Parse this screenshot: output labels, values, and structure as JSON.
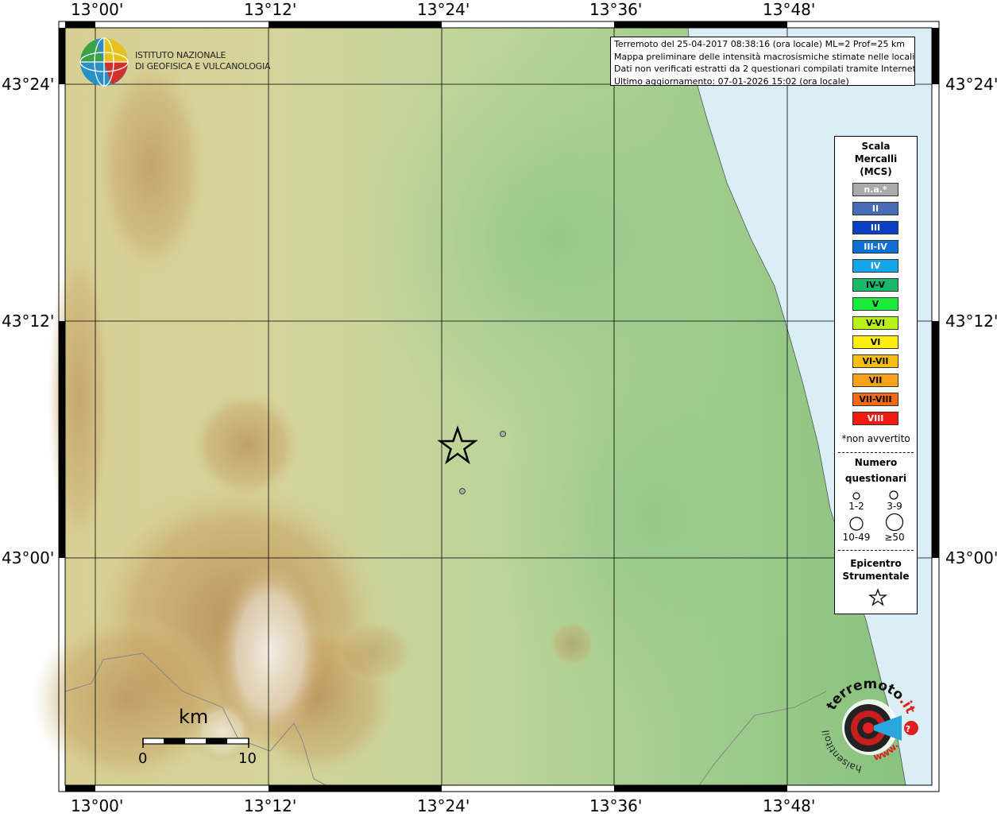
{
  "map": {
    "lon_ticks": [
      "13°00'",
      "13°12'",
      "13°24'",
      "13°36'",
      "13°48'"
    ],
    "lat_ticks": [
      "43°24'",
      "43°12'",
      "43°00'"
    ],
    "epicenter": {
      "lon": "13°24'",
      "lat": "43°06'"
    },
    "reports": [
      {
        "intensity": "n.a.*",
        "count": "1-2"
      },
      {
        "intensity": "n.a.*",
        "count": "1-2"
      }
    ],
    "colors": {
      "sea": "#dbeef6",
      "lowland": "#9cc98c",
      "hills": "#dcd49a",
      "mountains": "#b48a52",
      "peaks": "#f2efe8"
    }
  },
  "info": {
    "line1": "Terremoto del 25-04-2017 08:38:16 (ora locale) ML=2 Prof=25 km",
    "line2": "Mappa preliminare delle intensità macrosismiche stimate nelle località",
    "line3": "Dati non verificati estratti da 2 questionari compilati tramite Internet.",
    "line4": "Ultimo aggiornamento: 07-01-2026 15:02 (ora locale)"
  },
  "logo": {
    "name_line1": "ISTITUTO NAZIONALE",
    "name_line2": "DI GEOFISICA E VULCANOLOGIA"
  },
  "legend": {
    "title1": "Scala",
    "title2": "Mercalli",
    "title3": "(MCS)",
    "items": [
      {
        "label": "n.a.*",
        "color": "#aaaaaa",
        "text": "#ffffff"
      },
      {
        "label": "II",
        "color": "#4a6bb8",
        "text": "#ffffff"
      },
      {
        "label": "III",
        "color": "#0a3fc2",
        "text": "#ffffff"
      },
      {
        "label": "III-IV",
        "color": "#0b6fd6",
        "text": "#ffffff"
      },
      {
        "label": "IV",
        "color": "#14a6e8",
        "text": "#ffffff"
      },
      {
        "label": "IV-V",
        "color": "#1ab86a",
        "text": "#000000"
      },
      {
        "label": "V",
        "color": "#1aea3a",
        "text": "#000000"
      },
      {
        "label": "V-VI",
        "color": "#b8f01a",
        "text": "#000000"
      },
      {
        "label": "VI",
        "color": "#ffee10",
        "text": "#000000"
      },
      {
        "label": "VI-VII",
        "color": "#f7bd12",
        "text": "#000000"
      },
      {
        "label": "VII",
        "color": "#f7a21a",
        "text": "#000000"
      },
      {
        "label": "VII-VIII",
        "color": "#f76a12",
        "text": "#000000"
      },
      {
        "label": "VIII",
        "color": "#f01a10",
        "text": "#ffffff"
      }
    ],
    "not_felt_note": "*non avvertito",
    "count_title1": "Numero",
    "count_title2": "questionari",
    "counts": [
      "1-2",
      "3-9",
      "10-49",
      "≥50"
    ],
    "epicenter_title1": "Epicentro",
    "epicenter_title2": "Strumentale"
  },
  "scalebar": {
    "unit": "km",
    "start": "0",
    "end": "10"
  },
  "badge": {
    "text_top": "terremoto",
    "text_it": ".it",
    "text_left": "haisentitoil",
    "text_bottom": "www.",
    "question": "?"
  }
}
